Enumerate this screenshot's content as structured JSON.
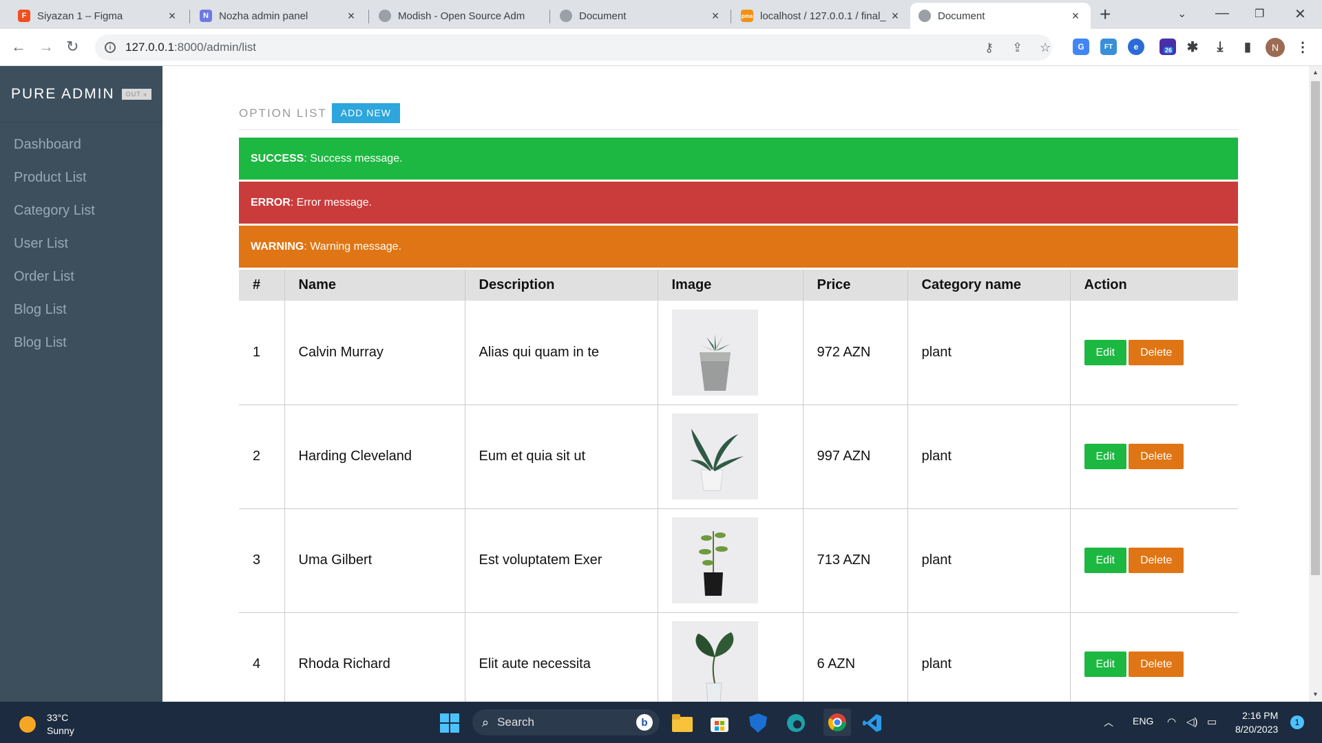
{
  "browser": {
    "tabs": [
      {
        "title": "Siyazan 1 – Figma",
        "favicon": "figma-icon",
        "color": "#f24e1e"
      },
      {
        "title": "Nozha admin panel",
        "favicon": "nozha-icon",
        "color": "#6c7ae0"
      },
      {
        "title": "Modish - Open Source Adm",
        "favicon": "globe-icon",
        "color": "#9aa0a6"
      },
      {
        "title": "Document",
        "favicon": "globe-icon",
        "color": "#9aa0a6"
      },
      {
        "title": "localhost / 127.0.0.1 / final_",
        "favicon": "phpmyadmin-icon",
        "color": "#f29111"
      },
      {
        "title": "Document",
        "favicon": "globe-icon",
        "color": "#9aa0a6",
        "active": true
      }
    ],
    "url_host": "127.0.0.1",
    "url_path": ":8000/admin/list",
    "extension_badge": "26",
    "profile_initial": "N"
  },
  "sidebar": {
    "brand": "PURE ADMIN",
    "brand_badge": "OUT »",
    "items": [
      {
        "label": "Dashboard"
      },
      {
        "label": "Product List"
      },
      {
        "label": "Category List"
      },
      {
        "label": "User List"
      },
      {
        "label": "Order List"
      },
      {
        "label": "Blog List"
      },
      {
        "label": "Blog List"
      }
    ]
  },
  "header": {
    "title": "OPTION LIST",
    "add_new": "ADD NEW"
  },
  "alerts": {
    "success": {
      "label": "SUCCESS",
      "message": ": Success message."
    },
    "error": {
      "label": "ERROR",
      "message": ": Error message."
    },
    "warning": {
      "label": "WARNING",
      "message": ": Warning message."
    }
  },
  "table": {
    "columns": [
      "#",
      "Name",
      "Description",
      "Image",
      "Price",
      "Category name",
      "Action"
    ],
    "rows": [
      {
        "id": "1",
        "name": "Calvin Murray",
        "description": "Alias qui quam in te",
        "image": "succulent-pot",
        "price": "972 AZN",
        "category": "plant"
      },
      {
        "id": "2",
        "name": "Harding Cleveland",
        "description": "Eum et quia sit ut",
        "image": "snake-plant",
        "price": "997 AZN",
        "category": "plant"
      },
      {
        "id": "3",
        "name": "Uma Gilbert",
        "description": "Est voluptatem Exer",
        "image": "seedling-bag",
        "price": "713 AZN",
        "category": "plant"
      },
      {
        "id": "4",
        "name": "Rhoda Richard",
        "description": "Elit aute necessita",
        "image": "leaf-vase",
        "price": "6 AZN",
        "category": "plant"
      }
    ],
    "edit_label": "Edit",
    "delete_label": "Delete"
  },
  "taskbar": {
    "temperature": "33°C",
    "weather": "Sunny",
    "search_label": "Search",
    "language": "ENG",
    "time": "2:16 PM",
    "date": "8/20/2023",
    "notifications": "1"
  },
  "colors": {
    "sidebar_bg": "#3d4f5d",
    "success": "#1cb841",
    "error": "#ca3c3c",
    "warning": "#df7514",
    "accent": "#2ca6dc"
  }
}
